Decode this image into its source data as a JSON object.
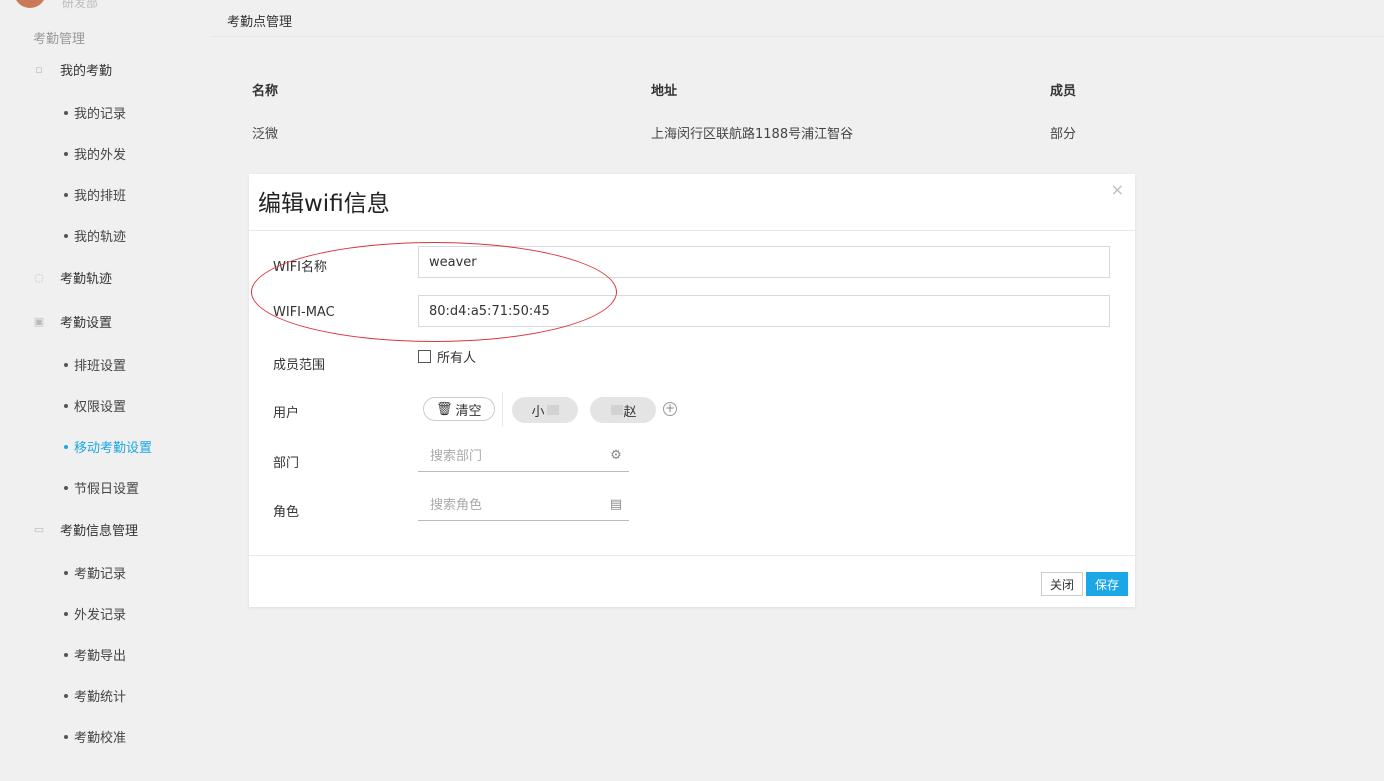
{
  "sidebar": {
    "dept_label": "研发部",
    "section_title": "考勤管理",
    "groups": [
      {
        "label": "我的考勤",
        "icon": "calendar-icon",
        "items": [
          "我的记录",
          "我的外发",
          "我的排班",
          "我的轨迹"
        ]
      },
      {
        "label": "考勤轨迹",
        "icon": "route-icon",
        "items": []
      },
      {
        "label": "考勤设置",
        "icon": "settings-icon",
        "items": [
          "排班设置",
          "权限设置",
          "移动考勤设置",
          "节假日设置"
        ]
      },
      {
        "label": "考勤信息管理",
        "icon": "document-icon",
        "items": [
          "考勤记录",
          "外发记录",
          "考勤导出",
          "考勤统计",
          "考勤校准"
        ]
      }
    ],
    "active_item": "移动考勤设置",
    "active_color": "#1ba7e5"
  },
  "main": {
    "page_title": "考勤点管理",
    "table": {
      "headers": [
        "名称",
        "地址",
        "成员"
      ],
      "rows": [
        [
          "泛微",
          "上海闵行区联航路1188号浦江智谷",
          "部分"
        ]
      ]
    }
  },
  "modal": {
    "title": "编辑wifi信息",
    "close_glyph": "×",
    "fields": {
      "wifi_name_label": "WIFI名称",
      "wifi_name_value": "weaver",
      "wifi_mac_label": "WIFI-MAC",
      "wifi_mac_value": "80:d4:a5:71:50:45",
      "member_scope_label": "成员范围",
      "all_people_label": "所有人",
      "user_label": "用户",
      "clear_label": "清空",
      "user_tags": [
        "小",
        "赵"
      ],
      "dept_label": "部门",
      "dept_placeholder": "搜索部门",
      "role_label": "角色",
      "role_placeholder": "搜索角色"
    },
    "buttons": {
      "close_label": "关闭",
      "save_label": "保存"
    },
    "highlight_color": "#d9363e"
  }
}
